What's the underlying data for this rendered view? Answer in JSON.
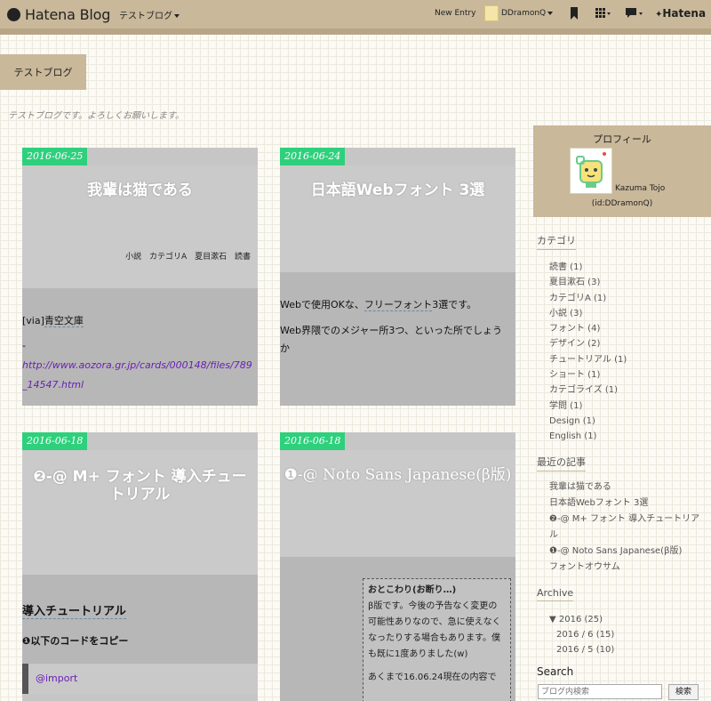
{
  "topbar": {
    "logo": "Hatena Blog",
    "blog_menu": "テストブログ",
    "new_entry": "New Entry",
    "user": "DDramonQ",
    "hatena": "Hatena"
  },
  "header": {
    "blog_title": "テストブログ",
    "description": "テストブログです。よろしくお願いします。"
  },
  "entries": [
    {
      "date": "2016-06-25",
      "title": "我輩は猫である",
      "categories": [
        "小説",
        "カテゴリA",
        "夏目漱石",
        "読書"
      ],
      "via_prefix": "[via]",
      "via_link": "青空文庫",
      "dash": "-",
      "url": "http://www.aozora.gr.jp/cards/000148/files/789_14547.html"
    },
    {
      "date": "2016-06-24",
      "title": "日本語Webフォント 3選",
      "para1_prefix": "Webで使用OKな、",
      "para1_link": "フリーフォント",
      "para1_suffix": "3選です。",
      "para2": "Web界隈でのメジャー所3つ、といった所でしょうか"
    },
    {
      "date": "2016-06-18",
      "title_line1": "❷-@ M+ フォント 導入チュー",
      "title_line2": "トリアル",
      "heading": "導入チュートリアル",
      "subheading": "❶以下のコードをコピー",
      "code": "@import"
    },
    {
      "date": "2016-06-18",
      "title": "❶-@ Noto Sans Japanese(β版)",
      "note_title": "おとこわり(お断り…)",
      "note_body": "β版です。今後の予告なく変更の可能性ありなので、急に使えなくなったりする場合もあります。僕も既に1度ありました(w)",
      "note_tail": "あくまで16.06.24現在の内容で"
    }
  ],
  "sidebar": {
    "profile_heading": "プロフィール",
    "profile_name": "Kazuma Tojo",
    "profile_id": "(id:DDramonQ)",
    "category_heading": "カテゴリ",
    "categories": [
      "読書 (1)",
      "夏目漱石 (3)",
      "カテゴリA (1)",
      "小説 (3)",
      "フォント (4)",
      "デザイン (2)",
      "チュートリアル (1)",
      "ショート (1)",
      "カテゴライズ (1)",
      "学問 (1)",
      "Design (1)",
      "English (1)"
    ],
    "recent_heading": "最近の記事",
    "recent": [
      "我輩は猫である",
      "日本語Webフォント 3選",
      "❷-@ M+ フォント 導入チュートリアル",
      "❶-@ Noto Sans Japanese(β版)",
      "フォントオウサム"
    ],
    "archive_heading": "Archive",
    "archive_year": "▼ 2016 (25)",
    "archive_months": [
      "2016 / 6 (15)",
      "2016 / 5 (10)"
    ],
    "search_heading": "Search",
    "search_placeholder": "ブログ内検索",
    "search_button": "検索"
  }
}
